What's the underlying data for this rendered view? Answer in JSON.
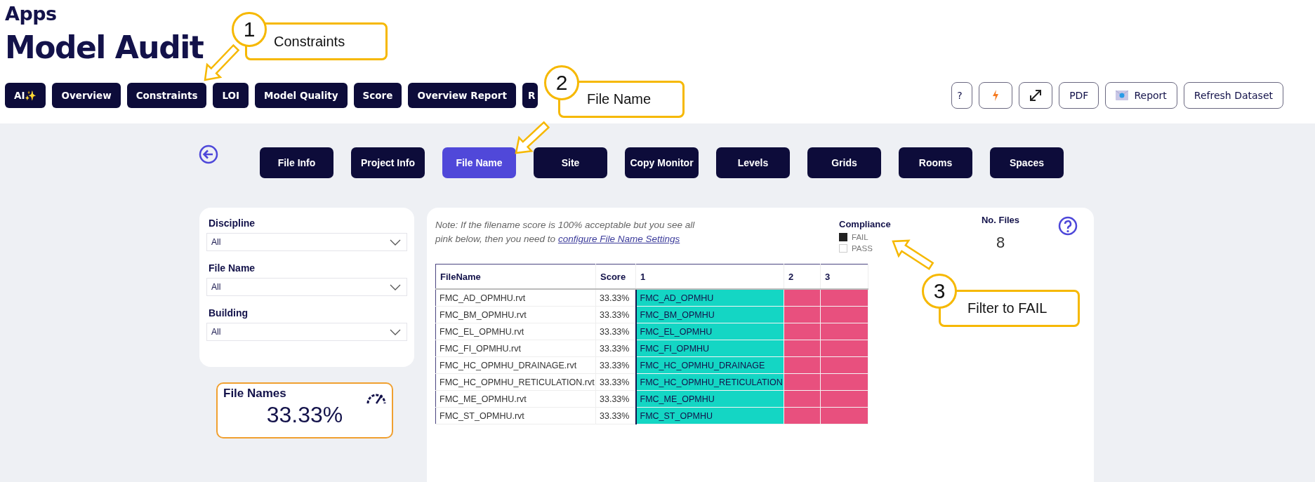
{
  "header": {
    "section": "Apps",
    "title": "Model Audit"
  },
  "nav_tabs": [
    {
      "label": "AI✨"
    },
    {
      "label": "Overview"
    },
    {
      "label": "Constraints"
    },
    {
      "label": "LOI"
    },
    {
      "label": "Model Quality"
    },
    {
      "label": "Score"
    },
    {
      "label": "Overview Report"
    },
    {
      "label": "R"
    }
  ],
  "toolbar": [
    {
      "kind": "text",
      "label": "?"
    },
    {
      "kind": "bolt"
    },
    {
      "kind": "expand"
    },
    {
      "kind": "text",
      "label": "PDF"
    },
    {
      "kind": "mail",
      "label": "Report"
    },
    {
      "kind": "text",
      "label": "Refresh Dataset"
    }
  ],
  "subnav": [
    {
      "label": "File Info",
      "selected": false
    },
    {
      "label": "Project Info",
      "selected": false
    },
    {
      "label": "File Name",
      "selected": true
    },
    {
      "label": "Site",
      "selected": false
    },
    {
      "label": "Copy Monitor",
      "selected": false
    },
    {
      "label": "Levels",
      "selected": false
    },
    {
      "label": "Grids",
      "selected": false
    },
    {
      "label": "Rooms",
      "selected": false
    },
    {
      "label": "Spaces",
      "selected": false
    }
  ],
  "filters": [
    {
      "label": "Discipline",
      "value": "All"
    },
    {
      "label": "File Name",
      "value": "All"
    },
    {
      "label": "Building",
      "value": "All"
    }
  ],
  "kpi": {
    "title": "File Names",
    "value": "33.33%"
  },
  "note": {
    "text": "Note: If the filename score is 100% acceptable but you see all pink below, then you need to ",
    "link": "configure File Name Settings"
  },
  "legend": {
    "title": "Compliance",
    "items": [
      {
        "label": "FAIL",
        "checked": true
      },
      {
        "label": "PASS",
        "checked": false
      }
    ]
  },
  "file_count": {
    "label": "No. Files",
    "value": "8"
  },
  "table": {
    "columns": [
      "FileName",
      "Score",
      "1",
      "2",
      "3"
    ],
    "rows": [
      {
        "file": "FMC_AD_OPMHU.rvt",
        "score": "33.33%",
        "segments": [
          {
            "text": "FMC_AD_OPMHU",
            "color": "#14d6c4"
          },
          {
            "color": "#e8507e"
          },
          {
            "color": "#e8507e"
          }
        ]
      },
      {
        "file": "FMC_BM_OPMHU.rvt",
        "score": "33.33%",
        "segments": [
          {
            "text": "FMC_BM_OPMHU",
            "color": "#14d6c4"
          },
          {
            "color": "#e8507e"
          },
          {
            "color": "#e8507e"
          }
        ]
      },
      {
        "file": "FMC_EL_OPMHU.rvt",
        "score": "33.33%",
        "segments": [
          {
            "text": "FMC_EL_OPMHU",
            "color": "#14d6c4"
          },
          {
            "color": "#e8507e"
          },
          {
            "color": "#e8507e"
          }
        ]
      },
      {
        "file": "FMC_FI_OPMHU.rvt",
        "score": "33.33%",
        "segments": [
          {
            "text": "FMC_FI_OPMHU",
            "color": "#14d6c4"
          },
          {
            "color": "#e8507e"
          },
          {
            "color": "#e8507e"
          }
        ]
      },
      {
        "file": "FMC_HC_OPMHU_DRAINAGE.rvt",
        "score": "33.33%",
        "segments": [
          {
            "text": "FMC_HC_OPMHU_DRAINAGE",
            "color": "#14d6c4"
          },
          {
            "color": "#e8507e"
          },
          {
            "color": "#e8507e"
          }
        ]
      },
      {
        "file": "FMC_HC_OPMHU_RETICULATION.rvt",
        "score": "33.33%",
        "segments": [
          {
            "text": "FMC_HC_OPMHU_RETICULATION",
            "color": "#14d6c4"
          },
          {
            "color": "#e8507e"
          },
          {
            "color": "#e8507e"
          }
        ]
      },
      {
        "file": "FMC_ME_OPMHU.rvt",
        "score": "33.33%",
        "segments": [
          {
            "text": "FMC_ME_OPMHU",
            "color": "#14d6c4"
          },
          {
            "color": "#e8507e"
          },
          {
            "color": "#e8507e"
          }
        ]
      },
      {
        "file": "FMC_ST_OPMHU.rvt",
        "score": "33.33%",
        "segments": [
          {
            "text": "FMC_ST_OPMHU",
            "color": "#14d6c4"
          },
          {
            "color": "#e8507e"
          },
          {
            "color": "#e8507e"
          }
        ]
      }
    ]
  },
  "annotations": [
    {
      "number": "1",
      "text": "Constraints"
    },
    {
      "number": "2",
      "text": "File Name"
    },
    {
      "number": "3",
      "text": "Filter to FAIL"
    }
  ]
}
